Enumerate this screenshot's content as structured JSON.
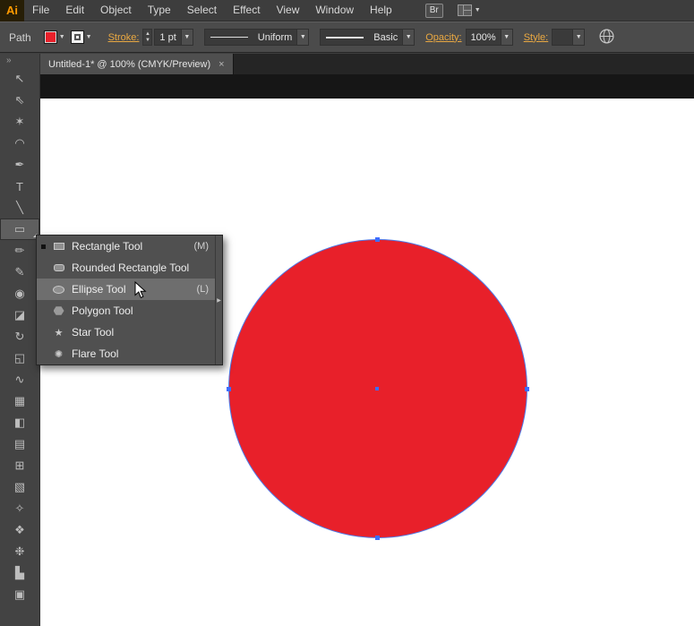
{
  "app": {
    "logo_text": "Ai"
  },
  "menubar": {
    "items": [
      "File",
      "Edit",
      "Object",
      "Type",
      "Select",
      "Effect",
      "View",
      "Window",
      "Help"
    ],
    "bridge_button": "Br"
  },
  "control_bar": {
    "selection_type": "Path",
    "stroke_label": "Stroke:",
    "stroke_weight": "1 pt",
    "variable_width_profile": "Uniform",
    "brush_definition": "Basic",
    "opacity_label": "Opacity:",
    "opacity_value": "100%",
    "style_label": "Style:",
    "fill_color": "#e8202a"
  },
  "document_tab": {
    "title": "Untitled-1* @ 100% (CMYK/Preview)",
    "close_glyph": "×"
  },
  "toolbar": {
    "collapse_glyph": "»",
    "tools": [
      {
        "name": "selection-tool",
        "glyph": "↖"
      },
      {
        "name": "direct-selection-tool",
        "glyph": "⇖"
      },
      {
        "name": "magic-wand-tool",
        "glyph": "✶"
      },
      {
        "name": "lasso-tool",
        "glyph": "◠"
      },
      {
        "name": "pen-tool",
        "glyph": "✒"
      },
      {
        "name": "type-tool",
        "glyph": "T"
      },
      {
        "name": "line-segment-tool",
        "glyph": "╲"
      },
      {
        "name": "rectangle-tool",
        "glyph": "▭",
        "selected": true
      },
      {
        "name": "paintbrush-tool",
        "glyph": "✏"
      },
      {
        "name": "pencil-tool",
        "glyph": "✎"
      },
      {
        "name": "blob-brush-tool",
        "glyph": "◉"
      },
      {
        "name": "eraser-tool",
        "glyph": "◪"
      },
      {
        "name": "rotate-tool",
        "glyph": "↻"
      },
      {
        "name": "scale-tool",
        "glyph": "◱"
      },
      {
        "name": "width-tool",
        "glyph": "∿"
      },
      {
        "name": "free-transform-tool",
        "glyph": "▦"
      },
      {
        "name": "shape-builder-tool",
        "glyph": "◧"
      },
      {
        "name": "perspective-grid-tool",
        "glyph": "▤"
      },
      {
        "name": "mesh-tool",
        "glyph": "⊞"
      },
      {
        "name": "gradient-tool",
        "glyph": "▧"
      },
      {
        "name": "eyedropper-tool",
        "glyph": "✧"
      },
      {
        "name": "blend-tool",
        "glyph": "❖"
      },
      {
        "name": "symbol-sprayer-tool",
        "glyph": "❉"
      },
      {
        "name": "column-graph-tool",
        "glyph": "▙"
      },
      {
        "name": "artboard-tool",
        "glyph": "▣"
      }
    ]
  },
  "flyout": {
    "items": [
      {
        "label": "Rectangle Tool",
        "shortcut": "(M)",
        "current": true
      },
      {
        "label": "Rounded Rectangle Tool",
        "shortcut": ""
      },
      {
        "label": "Ellipse Tool",
        "shortcut": "(L)",
        "highlighted": true
      },
      {
        "label": "Polygon Tool",
        "shortcut": ""
      },
      {
        "label": "Star Tool",
        "shortcut": "",
        "glyph": "★"
      },
      {
        "label": "Flare Tool",
        "shortcut": "",
        "glyph": "✺"
      }
    ],
    "more_glyph": "▶"
  },
  "canvas": {
    "shape": "ellipse",
    "fill_color": "#e8202a",
    "selection_color": "#4d79e8"
  }
}
